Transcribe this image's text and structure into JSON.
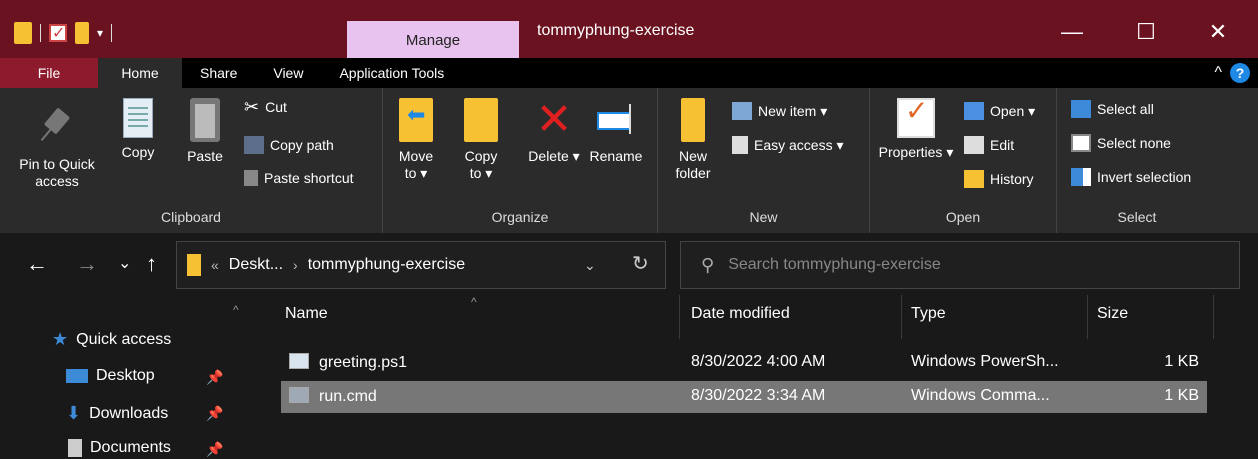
{
  "window": {
    "title": "tommyphung-exercise",
    "manage_tab": "Manage",
    "controls": {
      "minimize": "—",
      "maximize": "☐",
      "close": "✕"
    }
  },
  "quick_access_toolbar": {
    "icons": [
      "folder-icon",
      "properties-check-icon",
      "new-folder-icon"
    ],
    "dropdown": "▾"
  },
  "ribbon_tabs": [
    {
      "label": "File"
    },
    {
      "label": "Home",
      "active": true
    },
    {
      "label": "Share"
    },
    {
      "label": "View"
    },
    {
      "label": "Application Tools"
    }
  ],
  "ribbon_right": {
    "collapse": "^",
    "help": "?"
  },
  "ribbon": {
    "clipboard": {
      "label": "Clipboard",
      "pin": "Pin to Quick access",
      "copy": "Copy",
      "paste": "Paste",
      "cut": "Cut",
      "copy_path": "Copy path",
      "paste_shortcut": "Paste shortcut"
    },
    "organize": {
      "label": "Organize",
      "move_to": "Move to ▾",
      "copy_to": "Copy to ▾",
      "delete": "Delete ▾",
      "rename": "Rename"
    },
    "new": {
      "label": "New",
      "new_folder": "New folder",
      "new_item": "New item ▾",
      "easy_access": "Easy access ▾"
    },
    "open": {
      "label": "Open",
      "properties": "Properties ▾",
      "open": "Open ▾",
      "edit": "Edit",
      "history": "History"
    },
    "select": {
      "label": "Select",
      "select_all": "Select all",
      "select_none": "Select none",
      "invert_selection": "Invert selection"
    }
  },
  "address_bar": {
    "back": "←",
    "forward": "→",
    "recent": "⌄",
    "up": "↑",
    "overflow": "«",
    "crumb_parent": "Deskt...",
    "separator": "›",
    "crumb_current": "tommyphung-exercise",
    "dropdown": "⌄",
    "refresh": "↻"
  },
  "search": {
    "icon": "⚲",
    "placeholder": "Search tommyphung-exercise"
  },
  "nav_pane": {
    "quick_access": "Quick access",
    "items": [
      {
        "label": "Desktop",
        "icon": "desktop-icon",
        "pinned": true
      },
      {
        "label": "Downloads",
        "icon": "downloads-icon",
        "pinned": true
      },
      {
        "label": "Documents",
        "icon": "documents-icon",
        "pinned": true
      }
    ],
    "pin_glyph": "📌"
  },
  "file_list": {
    "columns": [
      "Name",
      "Date modified",
      "Type",
      "Size"
    ],
    "sort_indicator": "^",
    "rows": [
      {
        "name": "greeting.ps1",
        "date": "8/30/2022 4:00 AM",
        "type": "Windows PowerSh...",
        "size": "1 KB",
        "selected": false
      },
      {
        "name": "run.cmd",
        "date": "8/30/2022 3:34 AM",
        "type": "Windows Comma...",
        "size": "1 KB",
        "selected": true
      }
    ]
  },
  "colors": {
    "titlebar": "#6b1221",
    "file_tab": "#8e1a2d",
    "manage_tab": "#e9c3f0",
    "ribbon": "#2b2b2b",
    "background": "#191919",
    "selected_row": "#777777",
    "accent_blue": "#3d8ad8",
    "folder_yellow": "#f6c234",
    "delete_red": "#e02020"
  }
}
